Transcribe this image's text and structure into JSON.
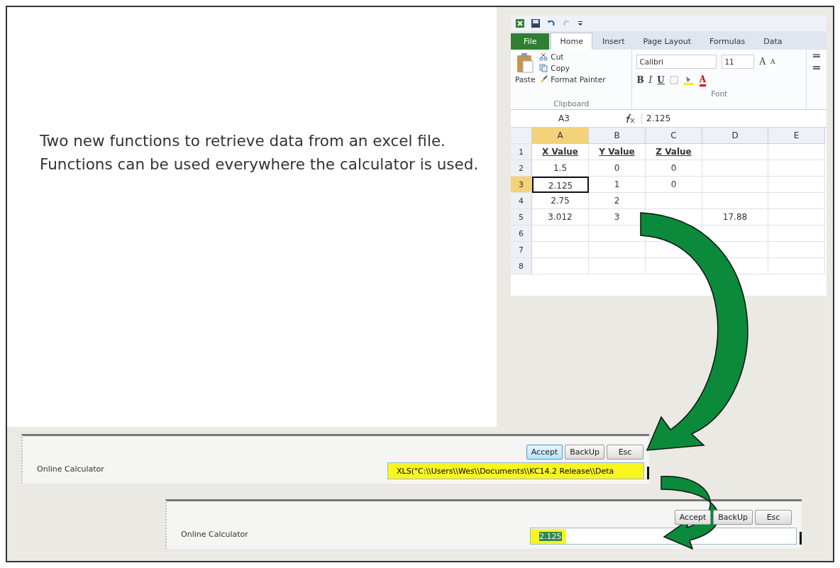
{
  "description": "Two new functions to retrieve data from an excel file. Functions can be used everywhere the calculator is used.",
  "spreadsheet": {
    "tabs": [
      {
        "label": "File",
        "kind": "file",
        "selected": false
      },
      {
        "label": "Home",
        "kind": "tab",
        "selected": true
      },
      {
        "label": "Insert",
        "kind": "tab",
        "selected": false
      },
      {
        "label": "Page Layout",
        "kind": "tab",
        "selected": false
      },
      {
        "label": "Formulas",
        "kind": "tab",
        "selected": false
      },
      {
        "label": "Data",
        "kind": "tab",
        "selected": false
      }
    ],
    "clipboard": {
      "paste": "Paste",
      "cut": "Cut",
      "copy": "Copy",
      "format_painter": "Format Painter",
      "group_label": "Clipboard"
    },
    "font": {
      "family": "Calibri",
      "size": "11",
      "grow": "A",
      "shrink": "A",
      "bold": "B",
      "italic": "I",
      "underline": "U",
      "font_color": "A",
      "group_label": "Font"
    },
    "name_box": "A3",
    "formula": "2.125",
    "columns": [
      {
        "label": "A",
        "selected": true
      },
      {
        "label": "B",
        "selected": false
      },
      {
        "label": "C",
        "selected": false
      },
      {
        "label": "D",
        "selected": false
      },
      {
        "label": "E",
        "selected": false
      }
    ],
    "rows": [
      {
        "number": "1",
        "kind": "header",
        "selected": false,
        "cells": [
          "X Value",
          "Y Value",
          "Z Value",
          "",
          ""
        ]
      },
      {
        "number": "2",
        "kind": "data",
        "selected": false,
        "cells": [
          "1.5",
          "0",
          "0",
          "",
          ""
        ]
      },
      {
        "number": "3",
        "kind": "data",
        "selected": true,
        "cells": [
          "2.125",
          "1",
          "0",
          "",
          ""
        ]
      },
      {
        "number": "4",
        "kind": "data",
        "selected": false,
        "cells": [
          "2.75",
          "2",
          "",
          "",
          ""
        ]
      },
      {
        "number": "5",
        "kind": "data",
        "selected": false,
        "cells": [
          "3.012",
          "3",
          "",
          "17.88",
          ""
        ]
      },
      {
        "number": "6",
        "kind": "data",
        "selected": false,
        "cells": [
          "",
          "",
          "",
          "",
          ""
        ]
      },
      {
        "number": "7",
        "kind": "data",
        "selected": false,
        "cells": [
          "",
          "",
          "",
          "",
          ""
        ]
      },
      {
        "number": "8",
        "kind": "data",
        "selected": false,
        "cells": [
          "",
          "",
          "",
          "",
          ""
        ]
      }
    ]
  },
  "calculators": [
    {
      "label": "Online Calculator",
      "buttons": [
        {
          "label": "Accept",
          "focused": true
        },
        {
          "label": "BackUp",
          "focused": false
        },
        {
          "label": "Esc",
          "focused": false
        }
      ],
      "value": "XLS(\"C:\\\\Users\\\\Wes\\\\Documents\\\\KC14.2 Release\\\\Deta",
      "value_selected": false
    },
    {
      "label": "Online Calculator",
      "buttons": [
        {
          "label": "Accept",
          "focused": false
        },
        {
          "label": "BackUp",
          "focused": false
        },
        {
          "label": "Esc",
          "focused": false
        }
      ],
      "value": "2.125",
      "value_selected": true
    }
  ]
}
